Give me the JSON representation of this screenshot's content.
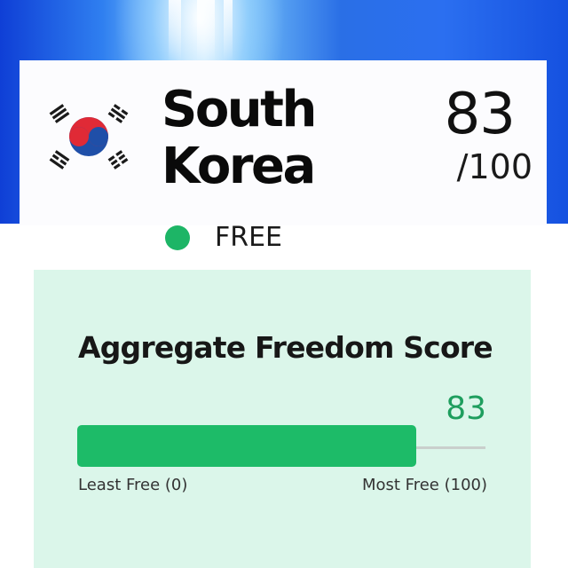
{
  "country": {
    "name_line1": "South",
    "name_line2": "Korea",
    "flag": "south-korea-flag-icon"
  },
  "score": {
    "value": "83",
    "max": "/100"
  },
  "status": {
    "label": "FREE",
    "color": "#1db566"
  },
  "aggregate": {
    "title": "Aggregate Freedom Score",
    "value": "83",
    "fraction": 0.83,
    "min_label": "Least Free (0)",
    "max_label": "Most Free (100)",
    "fill_color": "#1dbb68"
  },
  "colors": {
    "banner_blue": "#2b6ff0",
    "panel_bg": "#dbf6ea",
    "accent_green": "#1e9e5e"
  }
}
